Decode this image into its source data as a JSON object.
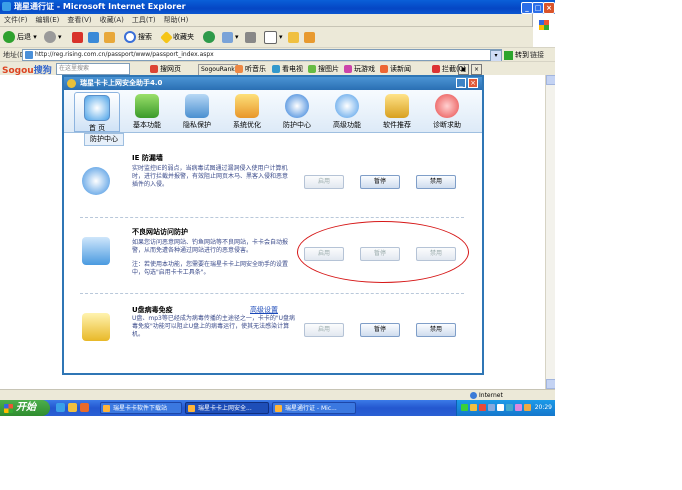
{
  "ie": {
    "title": "瑞星通行证 - Microsoft Internet Explorer",
    "menu": [
      "文件(F)",
      "编辑(E)",
      "查看(V)",
      "收藏(A)",
      "工具(T)",
      "帮助(H)"
    ],
    "toolbar": {
      "back": "后退",
      "search": "搜索",
      "favorites": "收藏夹"
    },
    "address_label": "地址(D)",
    "url": "http://reg.rising.com.cn/passport/www/passport_index.aspx",
    "go": "转到",
    "links": "链接",
    "status_zone": "Internet"
  },
  "sogou": {
    "logo_a": "Sogou",
    "logo_b": "搜狗",
    "search_placeholder": "在这里搜索",
    "items": [
      "搜网页",
      "SogouRank",
      "听音乐",
      "看电视",
      "搜图片",
      "玩游戏",
      "读新闻",
      "拦截(0)"
    ]
  },
  "app": {
    "title": "瑞星卡卡上网安全助手4.0",
    "nav": [
      "首 页",
      "基本功能",
      "隐私保护",
      "系统优化",
      "防护中心",
      "高级功能",
      "软件推荐",
      "诊断求助"
    ],
    "subtab": "防护中心",
    "sections": [
      {
        "title": "IE 防漏墙",
        "desc": "实时监控IE的弱点，当病毒试图通过漏洞侵入使用户计算机时，进行拦截并报警，有效阻止网页木马、黑客入侵和恶意插件的入侵。",
        "link": "",
        "buttons": [
          "启用",
          "暂停",
          "禁用"
        ]
      },
      {
        "title": "不良网站访问防护",
        "desc": "如果您访问恶意网站、钓鱼网站等不良网站，卡卡会自动报警，从而免遭各种通过网站进行的恶意侵害。",
        "desc2": "注：若使用本功能，您需要在瑞星卡卡上网安全助手的设置中，勾选\"启用卡卡工具条\"。",
        "link": "",
        "buttons": [
          "启用",
          "暂停",
          "禁用"
        ]
      },
      {
        "title": "U盘病毒免疫",
        "desc": "U盘、mp3等已经成为病毒传播的主途径之一，卡卡的\"U盘病毒免疫\"功能可以阻止U盘上的病毒运行，使其无法感染计算机。",
        "link": "高级设置",
        "buttons": [
          "启用",
          "暂停",
          "禁用"
        ]
      }
    ]
  },
  "taskbar": {
    "start": "开始",
    "tasks": [
      "瑞星卡卡软件下载站",
      "瑞星卡卡上网安全...",
      "瑞星通行证 - Mic..."
    ],
    "clock": "20:29"
  }
}
